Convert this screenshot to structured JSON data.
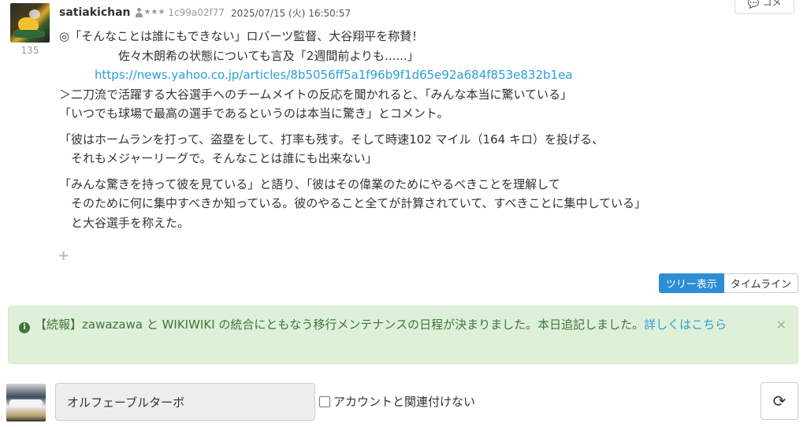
{
  "post": {
    "author": "satiakichan",
    "rank_stars": "★★★",
    "user_id": "1c99a02f77",
    "timestamp": "2025/07/15 (火) 16:50:57",
    "count": "135",
    "reply_label": "コメ",
    "lines": [
      "◎「そんなことは誰にもできない」ロバーツ監督、大谷翔平を称賛！",
      "　　　　　佐々木朗希の状態についても言及「2週間前よりも......」",
      "　　　https://news.yahoo.co.jp/articles/8b5056ff5a1f96b9f1d65e92a684f853e832b1ea",
      "＞二刀流で活躍する大谷選手へのチームメイトの反応を聞かれると、「みんな本当に驚いている」",
      "「いつでも球場で最高の選手であるというのは本当に驚き」とコメント。",
      "「彼はホームランを打って、盗塁をして、打率も残す。そして時速102 マイル（164 キロ）を投げる、",
      "　それもメジャーリーグで。そんなことは誰にも出来ない」",
      "「みんな驚きを持って彼を見ている」と語り、「彼はその偉業のためにやるべきことを理解して",
      "　そのために何に集中すべきか知っている。彼のやること全てが計算されていて、すべきことに集中している」",
      "　と大谷選手を称えた。"
    ],
    "link_url": "https://news.yahoo.co.jp/articles/8b5056ff5a1f96b9f1d65e92a684f853e832b1ea",
    "link_indent": "　　　"
  },
  "view_toggle": {
    "tree_label": "ツリー表示",
    "timeline_label": "タイムライン",
    "selected": "ツリー表示"
  },
  "alert": {
    "text": "【続報】zawazawa と WIKIWIKI の統合にともなう移行メンテナンスの日程が決まりました。本日追記しました。",
    "link_text": "詳しくはこちら"
  },
  "compose": {
    "name_value": "オルフェーブルターボ",
    "checkbox_label": "アカウントと関連付けない"
  },
  "colors": {
    "accent": "#2c8ed3",
    "link": "#2a9fd6",
    "alert_bg": "#dff0d8",
    "alert_text": "#3c763d"
  }
}
